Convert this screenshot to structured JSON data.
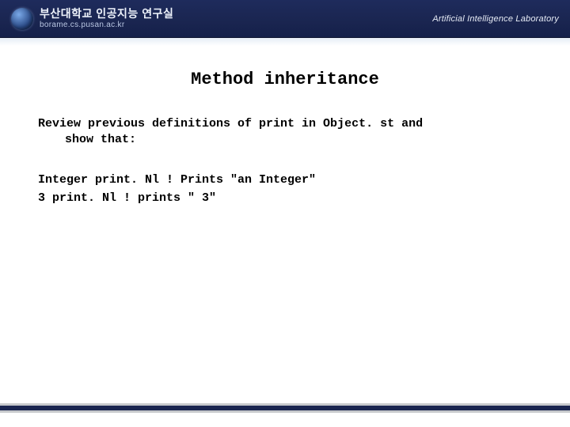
{
  "header": {
    "org_title": "부산대학교 인공지능 연구실",
    "org_sub": "borame.cs.pusan.ac.kr",
    "lab_label": "Artificial Intelligence Laboratory"
  },
  "slide": {
    "title": "Method inheritance",
    "intro_line1": "Review previous definitions of print in Object. st and",
    "intro_line2": "show that:",
    "code_line1": "Integer print. Nl ! Prints \"an Integer\"",
    "code_line2": "3 print. Nl ! prints \" 3\""
  }
}
